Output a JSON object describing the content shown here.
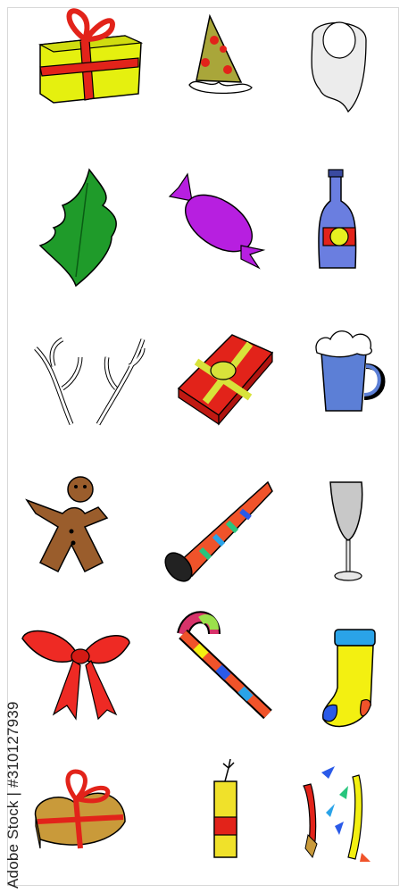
{
  "stock": {
    "watermark_text": "Adobe Stock | #310127939"
  },
  "icons": [
    {
      "name": "gift-box-icon",
      "colors": {
        "box": "#e5f00f",
        "ribbon": "#e2231a"
      }
    },
    {
      "name": "party-hat-icon",
      "colors": {
        "hat": "#a9a63a",
        "dots": "#e2231a"
      }
    },
    {
      "name": "santa-beard-icon",
      "colors": {
        "beard": "#ececec"
      }
    },
    {
      "name": "holly-leaf-icon",
      "colors": {
        "leaf": "#1f9b2a"
      }
    },
    {
      "name": "candy-icon",
      "colors": {
        "wrapper": "#b71fe0"
      }
    },
    {
      "name": "bottle-icon",
      "colors": {
        "glass": "#6a7ee0",
        "label": "#e2231a"
      }
    },
    {
      "name": "antlers-icon",
      "colors": {
        "antler": "#ffffff"
      }
    },
    {
      "name": "present-icon",
      "colors": {
        "box": "#e2231a",
        "ribbon": "#d8e33a"
      }
    },
    {
      "name": "beer-mug-icon",
      "colors": {
        "mug": "#5c7fd6",
        "foam": "#ffffff"
      }
    },
    {
      "name": "gingerbread-man-icon",
      "colors": {
        "cookie": "#9a5d2c"
      }
    },
    {
      "name": "party-horn-icon",
      "colors": {
        "horn": "#f0532a"
      }
    },
    {
      "name": "champagne-glass-icon",
      "colors": {
        "glass": "#c8c8c8"
      }
    },
    {
      "name": "bow-icon",
      "colors": {
        "bow": "#ee2a24"
      }
    },
    {
      "name": "candy-cane-icon",
      "colors": {
        "cane": "#d8336a"
      }
    },
    {
      "name": "christmas-stocking-icon",
      "colors": {
        "sock": "#f3f011",
        "cuff": "#2aa3e8"
      }
    },
    {
      "name": "heart-gift-box-icon",
      "colors": {
        "box": "#c99a3a",
        "ribbon": "#e2231a"
      }
    },
    {
      "name": "firecracker-icon",
      "colors": {
        "body": "#f0e12a",
        "band": "#e2231a"
      }
    },
    {
      "name": "confetti-icon",
      "colors": {
        "a": "#e2231a",
        "b": "#2a5ae8",
        "c": "#f3f011",
        "d": "#27c57d",
        "e": "#c99a3a"
      }
    }
  ]
}
